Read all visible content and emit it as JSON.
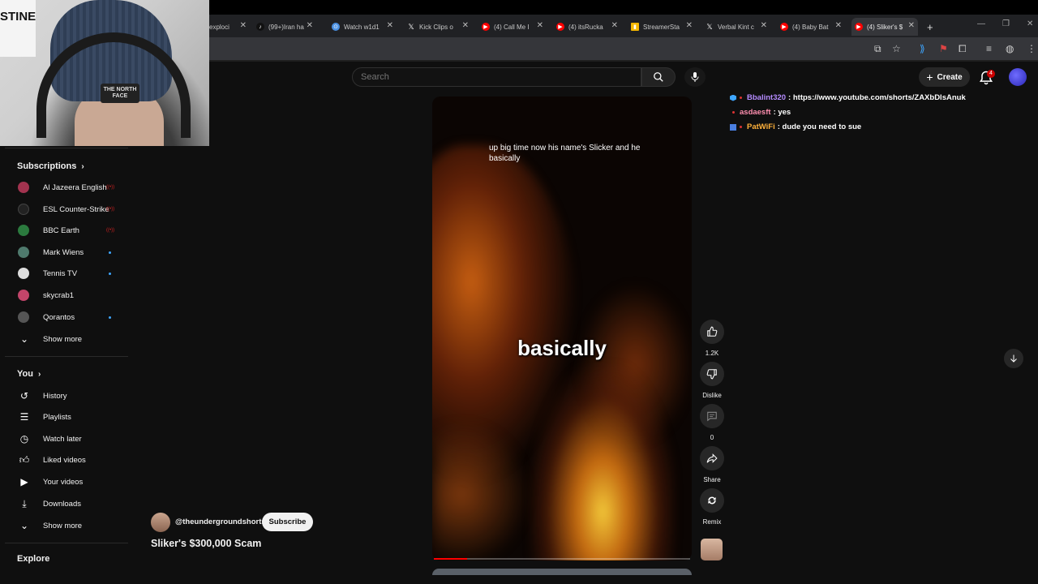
{
  "browser": {
    "tabs": [
      {
        "label": "exploci",
        "color": "#888888"
      },
      {
        "label": "(99+)Iran ha",
        "color": "#111111"
      },
      {
        "label": "Watch w1d1",
        "color": "#4a90e2"
      },
      {
        "label": "Kick Clips o",
        "color": "#111111"
      },
      {
        "label": "(4) Call Me I",
        "color": "#ff0000"
      },
      {
        "label": "(4) itsRucka",
        "color": "#ff0000"
      },
      {
        "label": "StreamerSta",
        "color": "#f5b700"
      },
      {
        "label": "Verbal Kint c",
        "color": "#111111"
      },
      {
        "label": "(4) Baby Bat",
        "color": "#ff0000"
      },
      {
        "label": "(4) Sliker's $",
        "color": "#ff0000"
      }
    ],
    "new_tab": "+"
  },
  "search": {
    "placeholder": "Search"
  },
  "header": {
    "create_label": "Create",
    "notif_count": "4"
  },
  "sidebar": {
    "subscriptions_title": "Subscriptions",
    "channels": [
      {
        "label": "Al Jazeera English",
        "color": "#a2334f",
        "status": "live"
      },
      {
        "label": "ESL Counter-Strike",
        "color": "#222222",
        "status": "live"
      },
      {
        "label": "BBC Earth",
        "color": "#2b7a3e",
        "status": "live"
      },
      {
        "label": "Mark Wiens",
        "color": "#4f7a6d",
        "status": "dot"
      },
      {
        "label": "Tennis TV",
        "color": "#dddddd",
        "status": "dot"
      },
      {
        "label": "skycrab1",
        "color": "#c2456a",
        "status": "none"
      },
      {
        "label": "Qorantos",
        "color": "#555555",
        "status": "dot"
      }
    ],
    "show_more_1": "Show more",
    "you_title": "You",
    "you_items": [
      {
        "label": "History",
        "icon": "history-icon"
      },
      {
        "label": "Playlists",
        "icon": "playlists-icon"
      },
      {
        "label": "Watch later",
        "icon": "clock-icon"
      },
      {
        "label": "Liked videos",
        "icon": "thumbs-up-icon"
      },
      {
        "label": "Your videos",
        "icon": "video-icon"
      },
      {
        "label": "Downloads",
        "icon": "download-icon"
      }
    ],
    "show_more_2": "Show more",
    "explore_title": "Explore"
  },
  "video": {
    "caption_top": "up big time now his name's Slicker and he basically",
    "caption_big": "basically",
    "progress": 0.13
  },
  "actions": {
    "like_count": "1.2K",
    "dislike_label": "Dislike",
    "comments_count": "0",
    "share_label": "Share",
    "remix_label": "Remix"
  },
  "channel": {
    "handle": "@theundergroundshorts",
    "subscribe_label": "Subscribe",
    "video_title": "Sliker's $300,000 Scam"
  },
  "chat": [
    {
      "user": "Bbalint320",
      "user_color": "#b58cff",
      "message": ": https://www.youtube.com/shorts/ZAXbDlsAnuk",
      "badge_color": "#3ea6ff"
    },
    {
      "user": "asdaesft",
      "user_color": "#ff8fb0",
      "message": ": yes",
      "badge_color": ""
    },
    {
      "user": "PatWiFi",
      "user_color": "#ffb13b",
      "message": ": dude you need to sue",
      "badge_color": "#4a7fe0"
    }
  ],
  "webcam": {
    "poster_text": "STINE",
    "beanie_logo": "THE NORTH FACE"
  }
}
